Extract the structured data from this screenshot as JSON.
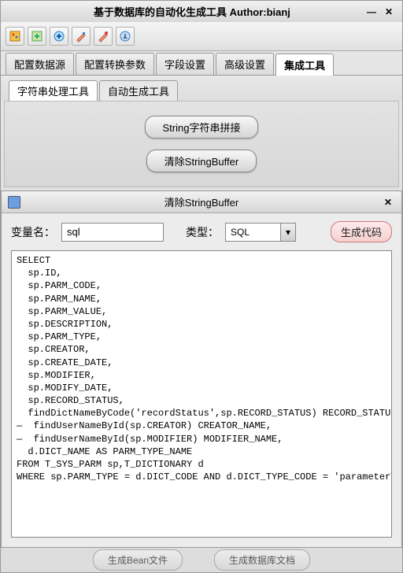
{
  "window": {
    "title": "基于数据库的自动化生成工具 Author:bianj"
  },
  "tabs": {
    "items": [
      {
        "label": "配置数据源"
      },
      {
        "label": "配置转换参数"
      },
      {
        "label": "字段设置"
      },
      {
        "label": "高级设置"
      },
      {
        "label": "集成工具"
      }
    ]
  },
  "subtabs": {
    "items": [
      {
        "label": "字符串处理工具"
      },
      {
        "label": "自动生成工具"
      }
    ]
  },
  "panel": {
    "btn1": "String字符串拼接",
    "btn2": "清除StringBuffer"
  },
  "subwindow": {
    "title": "清除StringBuffer",
    "var_label": "变量名：",
    "var_value": "sql",
    "type_label": "类型：",
    "type_value": "SQL",
    "gen_btn": "生成代码"
  },
  "code": "SELECT\n  sp.ID,\n  sp.PARM_CODE,\n  sp.PARM_NAME,\n  sp.PARM_VALUE,\n  sp.DESCRIPTION,\n  sp.PARM_TYPE,\n  sp.CREATOR,\n  sp.CREATE_DATE,\n  sp.MODIFIER,\n  sp.MODIFY_DATE,\n  sp.RECORD_STATUS,\n  findDictNameByCode('recordStatus',sp.RECORD_STATUS) RECORD_STATUS_NAME,\n—  findUserNameById(sp.CREATOR) CREATOR_NAME,\n—  findUserNameById(sp.MODIFIER) MODIFIER_NAME,\n  d.DICT_NAME AS PARM_TYPE_NAME\nFROM T_SYS_PARM sp,T_DICTIONARY d\nWHERE sp.PARM_TYPE = d.DICT_CODE AND d.DICT_TYPE_CODE = 'parameterType'",
  "bottom": {
    "btn1": "生成Bean文件",
    "btn2": "生成数据库文档"
  },
  "glyphs": {
    "min": "—",
    "close": "✕",
    "down": "▾"
  }
}
